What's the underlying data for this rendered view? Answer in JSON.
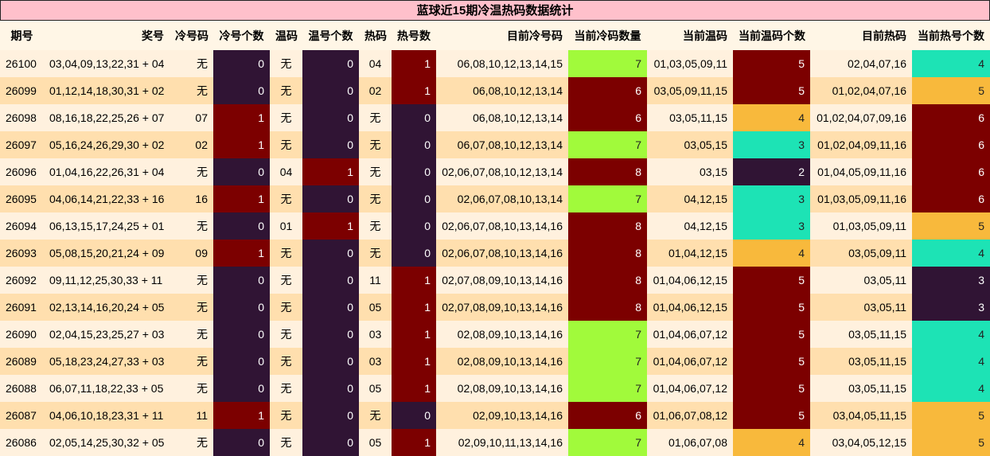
{
  "title": "蓝球近15期冷温热码数据统计",
  "headers": [
    "期号",
    "奖号",
    "冷号码",
    "冷号个数",
    "温码",
    "温号个数",
    "热码",
    "热号数",
    "目前冷号码",
    "当前冷码数量",
    "当前温码",
    "当前温码个数",
    "目前热码",
    "当前热号个数"
  ],
  "rows": [
    [
      "26100",
      "03,04,09,13,22,31 + 04",
      "无",
      "0",
      "无",
      "0",
      "04",
      "1",
      "06,08,10,12,13,14,15",
      "7",
      "01,03,05,09,11",
      "5",
      "02,04,07,16",
      "4"
    ],
    [
      "26099",
      "01,12,14,18,30,31 + 02",
      "无",
      "0",
      "无",
      "0",
      "02",
      "1",
      "06,08,10,12,13,14",
      "6",
      "03,05,09,11,15",
      "5",
      "01,02,04,07,16",
      "5"
    ],
    [
      "26098",
      "08,16,18,22,25,26 + 07",
      "07",
      "1",
      "无",
      "0",
      "无",
      "0",
      "06,08,10,12,13,14",
      "6",
      "03,05,11,15",
      "4",
      "01,02,04,07,09,16",
      "6"
    ],
    [
      "26097",
      "05,16,24,26,29,30 + 02",
      "02",
      "1",
      "无",
      "0",
      "无",
      "0",
      "06,07,08,10,12,13,14",
      "7",
      "03,05,15",
      "3",
      "01,02,04,09,11,16",
      "6"
    ],
    [
      "26096",
      "01,04,16,22,26,31 + 04",
      "无",
      "0",
      "04",
      "1",
      "无",
      "0",
      "02,06,07,08,10,12,13,14",
      "8",
      "03,15",
      "2",
      "01,04,05,09,11,16",
      "6"
    ],
    [
      "26095",
      "04,06,14,21,22,33 + 16",
      "16",
      "1",
      "无",
      "0",
      "无",
      "0",
      "02,06,07,08,10,13,14",
      "7",
      "04,12,15",
      "3",
      "01,03,05,09,11,16",
      "6"
    ],
    [
      "26094",
      "06,13,15,17,24,25 + 01",
      "无",
      "0",
      "01",
      "1",
      "无",
      "0",
      "02,06,07,08,10,13,14,16",
      "8",
      "04,12,15",
      "3",
      "01,03,05,09,11",
      "5"
    ],
    [
      "26093",
      "05,08,15,20,21,24 + 09",
      "09",
      "1",
      "无",
      "0",
      "无",
      "0",
      "02,06,07,08,10,13,14,16",
      "8",
      "01,04,12,15",
      "4",
      "03,05,09,11",
      "4"
    ],
    [
      "26092",
      "09,11,12,25,30,33 + 11",
      "无",
      "0",
      "无",
      "0",
      "11",
      "1",
      "02,07,08,09,10,13,14,16",
      "8",
      "01,04,06,12,15",
      "5",
      "03,05,11",
      "3"
    ],
    [
      "26091",
      "02,13,14,16,20,24 + 05",
      "无",
      "0",
      "无",
      "0",
      "05",
      "1",
      "02,07,08,09,10,13,14,16",
      "8",
      "01,04,06,12,15",
      "5",
      "03,05,11",
      "3"
    ],
    [
      "26090",
      "02,04,15,23,25,27 + 03",
      "无",
      "0",
      "无",
      "0",
      "03",
      "1",
      "02,08,09,10,13,14,16",
      "7",
      "01,04,06,07,12",
      "5",
      "03,05,11,15",
      "4"
    ],
    [
      "26089",
      "05,18,23,24,27,33 + 03",
      "无",
      "0",
      "无",
      "0",
      "03",
      "1",
      "02,08,09,10,13,14,16",
      "7",
      "01,04,06,07,12",
      "5",
      "03,05,11,15",
      "4"
    ],
    [
      "26088",
      "06,07,11,18,22,33 + 05",
      "无",
      "0",
      "无",
      "0",
      "05",
      "1",
      "02,08,09,10,13,14,16",
      "7",
      "01,04,06,07,12",
      "5",
      "03,05,11,15",
      "4"
    ],
    [
      "26087",
      "04,06,10,18,23,31 + 11",
      "11",
      "1",
      "无",
      "0",
      "无",
      "0",
      "02,09,10,13,14,16",
      "6",
      "01,06,07,08,12",
      "5",
      "03,04,05,11,15",
      "5"
    ],
    [
      "26086",
      "02,05,14,25,30,32 + 05",
      "无",
      "0",
      "无",
      "0",
      "05",
      "1",
      "02,09,10,11,13,14,16",
      "7",
      "01,06,07,08",
      "4",
      "03,04,05,12,15",
      "5"
    ]
  ],
  "colors": {
    "title_bg": "#ffc0cb",
    "zero": "#301434",
    "one": "#7c0000",
    "count_2_3": "#301434",
    "count_3": "#1de3b5",
    "count_4": "#f8b93c",
    "count_5_6_8": "#7c0000",
    "count_7": "#a1fa3b",
    "row_light": "#fff1de",
    "row_dark": "#ffdfae"
  }
}
